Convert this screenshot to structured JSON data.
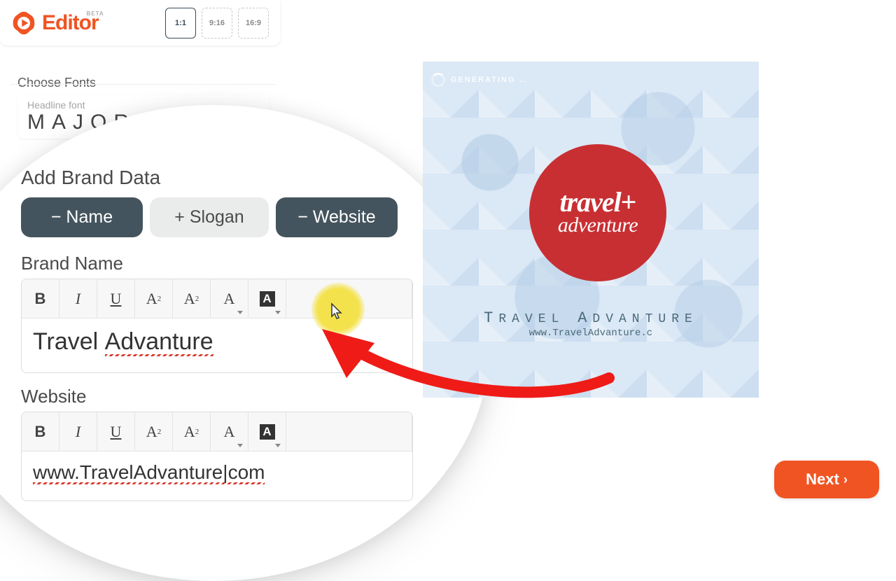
{
  "header": {
    "logo_text": "Editor",
    "badge": "BETA",
    "ratios": {
      "r1": "1:1",
      "r2": "9:16",
      "r3": "16:9"
    }
  },
  "sections": {
    "fonts_title": "Choose Fonts",
    "headline_label": "Headline font",
    "headline_value": "MAJOR",
    "brand_title": "Add Brand Data",
    "brandname_label": "Brand Name",
    "website_label": "Website"
  },
  "pills": {
    "name": "− Name",
    "slogan": "+ Slogan",
    "website": "− Website"
  },
  "fields": {
    "brand_value_pre": "Travel ",
    "brand_value_err": "Advanture",
    "website_value": "www.TravelAdvanture|com"
  },
  "canvas": {
    "status": "GENERATING …",
    "logo_line1a": "travel",
    "logo_plus": "+",
    "logo_line2": "adventure",
    "brand_disp_1": "T",
    "brand_disp_2": "RAVEL ",
    "brand_disp_3": "A",
    "brand_disp_4": "DVANTURE",
    "url_disp": "www.TravelAdvanture.c"
  },
  "footer": {
    "next": "Next"
  },
  "tb": {
    "b": "B",
    "i": "I",
    "u": "U",
    "a": "A",
    "two": "2"
  }
}
